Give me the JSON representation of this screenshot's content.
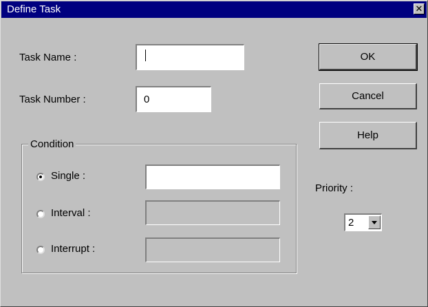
{
  "window": {
    "title": "Define Task",
    "close_glyph": "✕"
  },
  "task_name": {
    "label": "Task Name :",
    "value": ""
  },
  "task_number": {
    "label": "Task Number :",
    "value": "0"
  },
  "condition": {
    "legend": "Condition",
    "selected": "single",
    "options": [
      {
        "label": "Single :",
        "value": "",
        "enabled": true
      },
      {
        "label": "Interval :",
        "value": "",
        "enabled": false
      },
      {
        "label": "Interrupt :",
        "value": "",
        "enabled": false
      }
    ]
  },
  "buttons": {
    "ok": "OK",
    "cancel": "Cancel",
    "help": "Help"
  },
  "priority": {
    "label": "Priority :",
    "value": "2"
  },
  "icons": {
    "close": "close-icon",
    "dropdown": "chevron-down-icon"
  }
}
